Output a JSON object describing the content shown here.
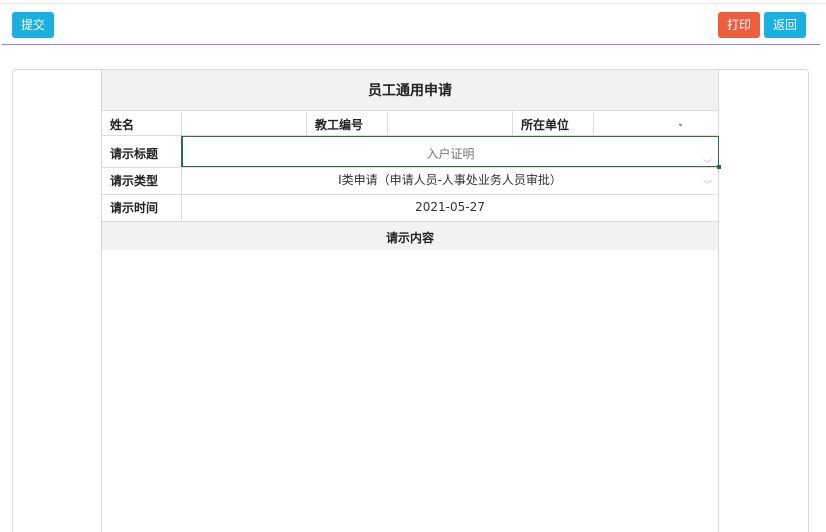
{
  "toolbar": {
    "submit_label": "提交",
    "print_label": "打印",
    "back_label": "返回"
  },
  "form": {
    "title": "员工通用申请",
    "row1": {
      "name_label": "姓名",
      "name_value": "",
      "staff_no_label": "教工编号",
      "staff_no_value": "",
      "unit_label": "所在单位",
      "unit_value": ""
    },
    "subject": {
      "label": "请示标题",
      "value": "入户证明"
    },
    "type": {
      "label": "请示类型",
      "value": "Ⅰ类申请（申请人员-人事处业务人员审批）"
    },
    "time": {
      "label": "请示时间",
      "value": "2021-05-27"
    },
    "content": {
      "label": "请示内容",
      "value": ""
    }
  },
  "colors": {
    "primary_button": "#1ab0e0",
    "danger_button": "#ee5d3e",
    "divider": "#9b7fd6",
    "focus_border": "#2e6b47",
    "header_bg": "#f2f2f2"
  }
}
